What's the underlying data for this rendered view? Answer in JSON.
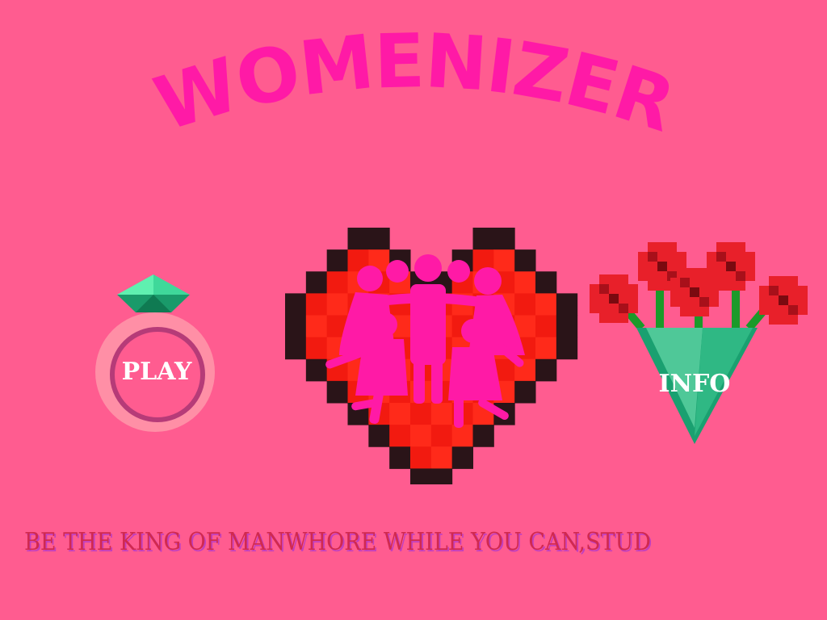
{
  "title": "WOMENIZER",
  "play_label": "PLAY",
  "info_label": "INFO",
  "tagline": "BE THE KING OF MANWHORE WHILE YOU CAN,STUD",
  "icons": {
    "gem": "emerald-gem-icon",
    "heart": "pixel-heart-icon",
    "family": "family-silhouette-icon",
    "bouquet": "rose-bouquet-icon"
  },
  "colors": {
    "background": "#ff5c90",
    "title": "#ff1aa6",
    "heart_red": "#ff2a1a",
    "heart_dark": "#2a1418",
    "silhouette": "#ff1aa6",
    "play_ring": "#ff8fa6",
    "play_inner": "#b63b78",
    "vase": "#2fb884",
    "tagline": "#d1294f"
  }
}
